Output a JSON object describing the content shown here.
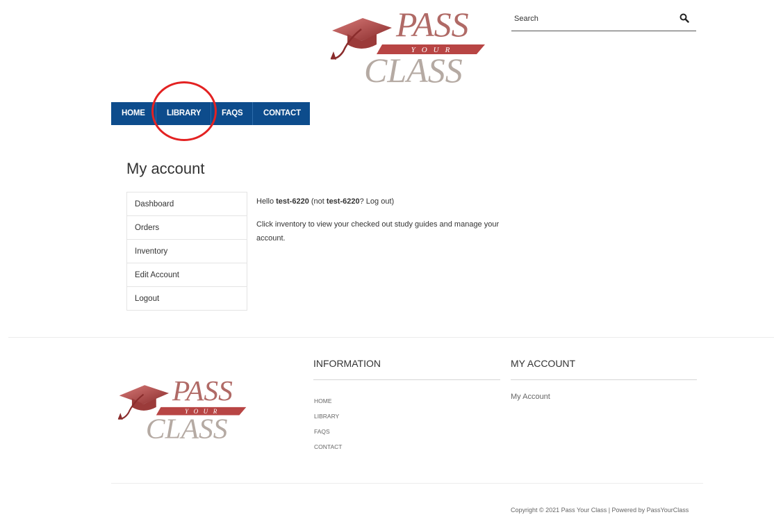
{
  "brand": {
    "logo_line1": "PASS",
    "logo_line2": "YOUR",
    "logo_line3": "CLASS"
  },
  "search": {
    "placeholder": "Search"
  },
  "nav": {
    "home": "HOME",
    "library": "LIBRARY",
    "faqs": "FAQS",
    "contact": "CONTACT"
  },
  "page": {
    "title": "My account"
  },
  "account_nav": {
    "items": [
      {
        "label": "Dashboard"
      },
      {
        "label": "Orders"
      },
      {
        "label": "Inventory"
      },
      {
        "label": "Edit Account"
      },
      {
        "label": "Logout"
      }
    ]
  },
  "dashboard": {
    "hello": "Hello ",
    "username": "test-6220",
    "not_prefix": " (not ",
    "username2": "test-6220",
    "qmark": "? ",
    "logout_link": "Log out",
    "close_paren": ")",
    "message": "Click inventory to view your checked out study guides and manage your account."
  },
  "footer": {
    "info_title": "INFORMATION",
    "info_links": [
      "HOME",
      "LIBRARY",
      "FAQS",
      "CONTACT"
    ],
    "account_title": "MY ACCOUNT",
    "account_link": "My Account",
    "copyright": "Copyright © 2021 Pass Your Class | Powered by PassYourClass"
  },
  "colors": {
    "nav_blue": "#0d4c8c",
    "logo_red": "#a5403f",
    "logo_gray": "#b5aaa3",
    "highlight_circle": "#e32222"
  }
}
